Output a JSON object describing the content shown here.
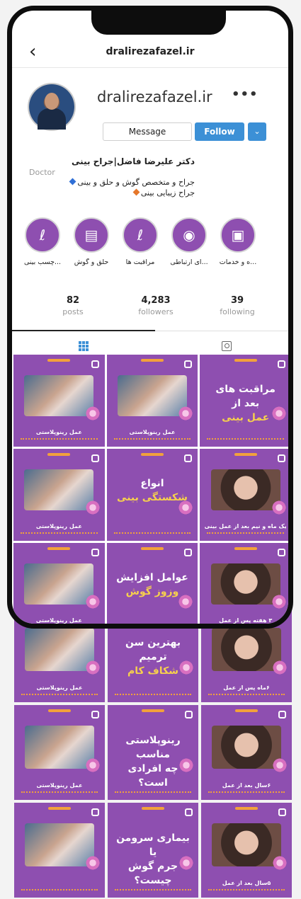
{
  "topbar": {
    "back_icon": "chevron-left-icon",
    "title": "dralirezafazel.ir"
  },
  "profile": {
    "username": "dralirezafazel.ir",
    "more_label": "•••",
    "message_label": "Message",
    "follow_label": "Follow",
    "dropdown_icon": "chevron-down-icon"
  },
  "bio": {
    "name": "دکتر علیرضا فاضل|جراح بینی",
    "category": "Doctor",
    "line1": "جراح و متخصص گوش و حلق و بینی",
    "line2": "جراح زیبایی بینی",
    "line1_marker_color": "#2f6fd6",
    "line2_marker_color": "#e5772a"
  },
  "highlights": [
    {
      "label": "...ه و خدمات",
      "icon": "monitor-icon"
    },
    {
      "label": "...ای ارتباطی",
      "icon": "contact-icon"
    },
    {
      "label": "مراقبت ها",
      "icon": "nose-icon"
    },
    {
      "label": "حلق و گوش",
      "icon": "book-icon"
    },
    {
      "label": "...چسب بینی",
      "icon": "nose-icon"
    }
  ],
  "stats": {
    "posts": {
      "value": "82",
      "label": "posts"
    },
    "followers": {
      "value": "4,283",
      "label": "followers"
    },
    "following": {
      "value": "39",
      "label": "following"
    }
  },
  "tabs": [
    {
      "name": "grid",
      "icon": "grid-icon"
    },
    {
      "name": "tagged",
      "icon": "tagged-icon"
    }
  ],
  "posts_inside": [
    {
      "kind": "photo",
      "photo": "surgery",
      "caption": "عمل رینوپلاستی"
    },
    {
      "kind": "photo",
      "photo": "surgery",
      "caption": "عمل رینوپلاستی"
    },
    {
      "kind": "text",
      "title": "مراقبت های",
      "title2": "بعد از",
      "accent": "عمل بینی"
    },
    {
      "kind": "photo",
      "photo": "surgery",
      "caption": "عمل رینوپلاستی"
    },
    {
      "kind": "text",
      "title": "انواع",
      "title2": "",
      "accent": "شکستگی بینی"
    },
    {
      "kind": "photo",
      "photo": "portrait",
      "caption": "یک ماه و نیم بعد از عمل بینی"
    },
    {
      "kind": "photo",
      "photo": "surgery",
      "caption": "عمل رینوپلاستی"
    },
    {
      "kind": "text",
      "title": "عوامل افزایش",
      "title2": "",
      "accent": "وزوز گوش"
    },
    {
      "kind": "photo",
      "photo": "portrait",
      "caption": "۳ هفته پس از عمل"
    }
  ],
  "posts_outside": [
    {
      "kind": "photo",
      "photo": "surgery",
      "caption": "عمل رینوپلاستی"
    },
    {
      "kind": "text",
      "title": "بهترین سن ترمیم",
      "title2": "",
      "accent": "شکاف کام"
    },
    {
      "kind": "photo",
      "photo": "portrait",
      "caption": "۶ماه پس از عمل"
    },
    {
      "kind": "photo",
      "photo": "surgery",
      "caption": "عمل رینوپلاستی"
    },
    {
      "kind": "text",
      "title": "رینوپلاستی مناسب",
      "title2": "چه افرادی است؟",
      "accent": ""
    },
    {
      "kind": "photo",
      "photo": "portrait",
      "caption": "۶سال بعد از عمل"
    },
    {
      "kind": "photo",
      "photo": "surgery",
      "caption": ""
    },
    {
      "kind": "text",
      "title": "بیماری سرومن یا",
      "title2": "جرم گوش چیست؟",
      "accent": ""
    },
    {
      "kind": "photo",
      "photo": "portrait",
      "caption": "۵سال بعد از عمل"
    }
  ]
}
